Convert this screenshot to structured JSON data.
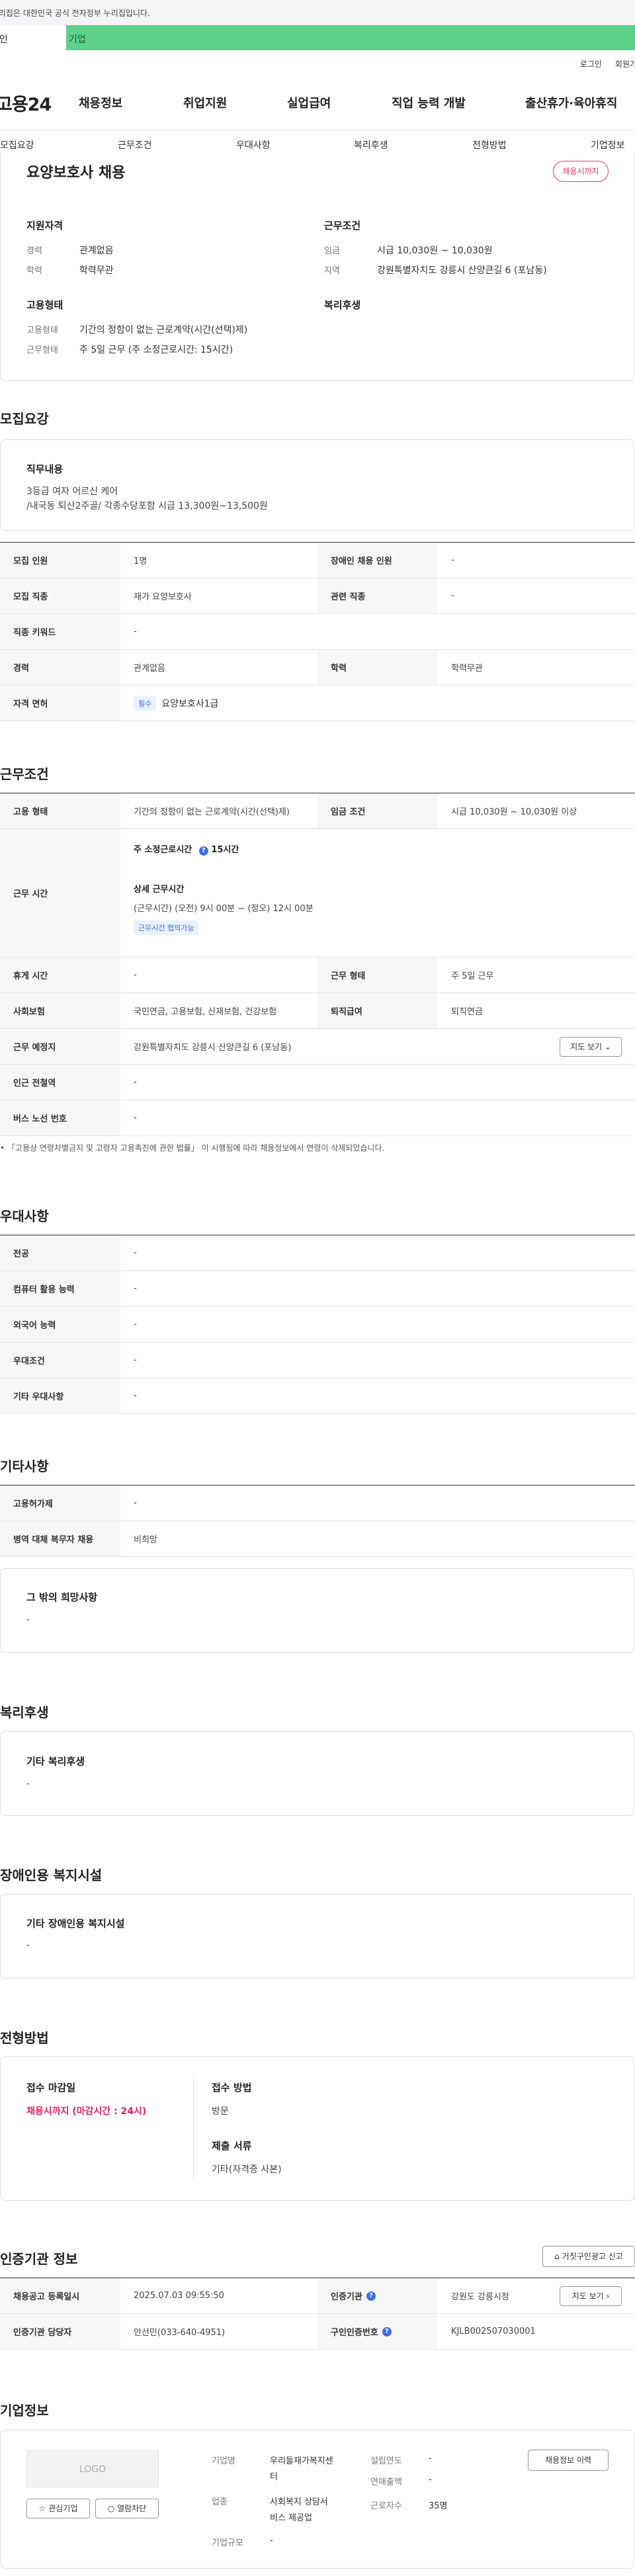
{
  "gov_bar": {
    "text": "이 누리집은 대한민국 공식 전자정부 누리집입니다."
  },
  "user_tabs": {
    "personal": "개인",
    "company": "기업"
  },
  "util": {
    "login": "로그인",
    "join": "회원가입"
  },
  "header": {
    "logo": "고용24",
    "menu": [
      "채용정보",
      "취업지원",
      "실업급여",
      "직업 능력 개발",
      "출산휴가·육아휴직"
    ]
  },
  "subnav": [
    "모집요강",
    "근무조건",
    "우대사항",
    "복리후생",
    "전형방법",
    "기업정보"
  ],
  "summary": {
    "title": "요양보호사 채용",
    "badge": "채용시까지",
    "qual_head": "지원자격",
    "career_k": "경력",
    "career_v": "관계없음",
    "edu_k": "학력",
    "edu_v": "학력무관",
    "cond_head": "근무조건",
    "wage_k": "임금",
    "wage_v": "시급 10,030원 ~ 10,030원",
    "region_k": "지역",
    "region_v": "강원특별자치도 강릉시 산양큰길 6 (포남동)",
    "emp_head": "고용형태",
    "emptype_k": "고용형태",
    "emptype_v": "기간의 정함이 없는 근로계약(시간(선택)제)",
    "worktype_k": "근무형태",
    "worktype_v": "주 5일 근무 (주 소정근로시간: 15시간)",
    "welfare_head": "복리후생"
  },
  "recruit": {
    "title": "모집요강",
    "duty_head": "직무내용",
    "duty_lines": [
      "3등급 여자 어르신 케어",
      "/내국동 퇴산2주골/ 각종수당포함 시급 13,300원~13,500원"
    ],
    "rows": [
      {
        "k": "모집 인원",
        "v": "1명",
        "k2": "장애인 채용 인원",
        "v2": "-"
      },
      {
        "k": "모집 직종",
        "v": "재가 요양보호사",
        "k2": "관련 직종",
        "v2": "-"
      },
      {
        "k": "직종 키워드",
        "v": "-"
      },
      {
        "k": "경력",
        "v": "관계없음",
        "k2": "학력",
        "v2": "학력무관"
      }
    ],
    "license_k": "자격 면허",
    "license_tag": "필수",
    "license_v": "요양보호사1급"
  },
  "conditions": {
    "title": "근무조건",
    "emp_k": "고용 형태",
    "emp_v": "기간의 정함이 없는 근로계약(시간(선택)제)",
    "wage_k": "임금 조건",
    "wage_v": "시급 10,030원 ~ 10,030원 이상",
    "hours_k": "근무 시간",
    "hours_week": "주 소정근로시간",
    "hours_week_v": "15시간",
    "hours_detail_head": "상세 근무시간",
    "hours_detail": "(근무시간) (오전) 9시 00분 ~ (정오) 12시 00분",
    "hours_tag": "근무시간 협의가능",
    "rest_k": "휴게 시간",
    "rest_v": "-",
    "form_k": "근무 형태",
    "form_v": "주 5일 근무",
    "ins_k": "사회보험",
    "ins_v": "국민연금, 고용보험, 산재보험, 건강보험",
    "ret_k": "퇴직급여",
    "ret_v": "퇴직연금",
    "place_k": "근무 예정지",
    "place_v": "강원특별자치도 강릉시 산양큰길 6 (포남동)",
    "map_btn": "지도 보기",
    "station_k": "인근 전철역",
    "station_v": "-",
    "bus_k": "버스 노선 번호",
    "bus_v": "-",
    "note": "「고용상 연령차별금지 및 고령자 고용촉진에 관한 법률」 이 시행됨에 따라 채용정보에서 연령이 삭제되었습니다."
  },
  "preference": {
    "title": "우대사항",
    "rows": [
      {
        "k": "전공",
        "v": "-"
      },
      {
        "k": "컴퓨터 활용 능력",
        "v": "-"
      },
      {
        "k": "외국어 능력",
        "v": "-"
      },
      {
        "k": "우대조건",
        "v": "-"
      },
      {
        "k": "기타 우대사항",
        "v": "-"
      }
    ]
  },
  "etc": {
    "title": "기타사항",
    "rows": [
      {
        "k": "고용허가제",
        "v": "-"
      },
      {
        "k": "병역 대체 복무자 채용",
        "v": "비희망"
      }
    ],
    "other_head": "그 밖의 희망사항",
    "other_v": "-"
  },
  "welfare": {
    "title": "복리후생",
    "head": "기타 복리후생",
    "v": "-"
  },
  "disability": {
    "title": "장애인용 복지시설",
    "head": "기타 장애인용 복지시설",
    "v": "-"
  },
  "selection": {
    "title": "전형방법",
    "deadline_head": "접수 마감일",
    "deadline_v": "채용시까지 (마감시간 : 24시)",
    "method_head": "접수 방법",
    "method_v": "방문",
    "docs_head": "제출 서류",
    "docs_v": "기타(자격증 사본)"
  },
  "cert": {
    "title": "인증기관 정보",
    "report_btn": "거짓구인광고 신고",
    "reg_k": "채용공고 등록일시",
    "reg_v": "2025.07.03 09:55:50",
    "org_k": "인증기관",
    "org_v": "강원도 강릉시청",
    "view_btn": "지도 보기",
    "mgr_k": "인증기관 담당자",
    "mgr_v": "안선민(033-640-4951)",
    "num_k": "구인인증번호",
    "num_v": "KJLB002507030001"
  },
  "company": {
    "title": "기업정보",
    "logo": "LOGO",
    "fav_btn": "관심기업",
    "block_btn": "열람차단",
    "name_k": "기업명",
    "name_v": [
      "우리들재가복지센",
      "터"
    ],
    "industry_k": "업종",
    "industry_v": [
      "사회복지 상담서",
      "비스 제공업"
    ],
    "size_k": "기업규모",
    "size_v": "-",
    "year_k": "설립연도",
    "year_v": "-",
    "sales_k": "연매출액",
    "sales_v": "-",
    "emp_k": "근로자수",
    "emp_v": "35명",
    "history_btn": "채용정보 이력"
  }
}
